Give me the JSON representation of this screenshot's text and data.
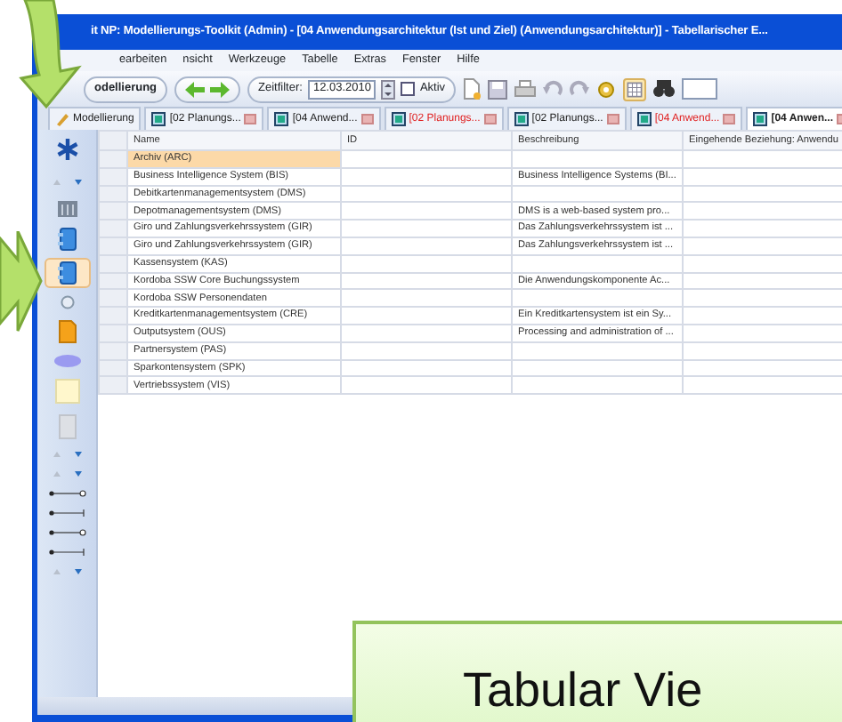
{
  "window": {
    "title": "it NP: Modellierungs-Toolkit (Admin) - [04 Anwendungsarchitektur (Ist und Ziel) (Anwendungsarchitektur)] - Tabellarischer E..."
  },
  "menu": [
    "earbeiten",
    "nsicht",
    "Werkzeuge",
    "Tabelle",
    "Extras",
    "Fenster",
    "Hilfe"
  ],
  "toolbar": {
    "mode": "odellierung",
    "filter_label": "Zeitfilter:",
    "date": "12.03.2010",
    "active": {
      "label": "Aktiv",
      "checked": false
    },
    "table_view_selected": true
  },
  "tabs": [
    {
      "label": "Modellierung",
      "color": "#222222",
      "selected": false
    },
    {
      "label": "[02 Planungs...",
      "color": "#222222",
      "selected": false
    },
    {
      "label": "[04 Anwend...",
      "color": "#222222",
      "selected": false
    },
    {
      "label": "[02 Planungs...",
      "color": "#e02020",
      "selected": false
    },
    {
      "label": "[02 Planungs...",
      "color": "#222222",
      "selected": false
    },
    {
      "label": "[04 Anwend...",
      "color": "#e02020",
      "selected": false
    },
    {
      "label": "[04 Anwen...",
      "color": "#222222",
      "selected": true
    }
  ],
  "sidebar": {
    "items": [
      {
        "kind": "asterisk",
        "selected": false
      },
      {
        "kind": "scroll",
        "selected": false
      },
      {
        "kind": "building",
        "selected": false
      },
      {
        "kind": "component",
        "selected": false
      },
      {
        "kind": "component",
        "selected": true
      },
      {
        "kind": "circle",
        "selected": false
      },
      {
        "kind": "document",
        "selected": false
      },
      {
        "kind": "ellipse",
        "selected": false
      },
      {
        "kind": "note",
        "selected": false
      },
      {
        "kind": "frame",
        "selected": false
      },
      {
        "kind": "scroll",
        "selected": false
      },
      {
        "kind": "scroll",
        "selected": false
      },
      {
        "kind": "connector-circle",
        "selected": false
      },
      {
        "kind": "connector-bar",
        "selected": false
      },
      {
        "kind": "connector-circle",
        "selected": false
      },
      {
        "kind": "connector-bar",
        "selected": false
      },
      {
        "kind": "scroll",
        "selected": false
      }
    ]
  },
  "table": {
    "columns": [
      "Name",
      "ID",
      "Beschreibung",
      "Eingehende Beziehung: Anwendu"
    ],
    "rows": [
      {
        "name": "Archiv (ARC)",
        "description": "",
        "selected": true
      },
      {
        "name": "Business Intelligence System (BIS)",
        "description": "Business Intelligence Systems (BI...",
        "selected": false
      },
      {
        "name": "Debitkartenmanagementsystem (DMS)",
        "description": "",
        "selected": false
      },
      {
        "name": "Depotmanagementsystem (DMS)",
        "description": "DMS is a web-based system pro...",
        "selected": false
      },
      {
        "name": "Giro und Zahlungsverkehrssystem (GIR)",
        "description": "Das Zahlungsverkehrssystem ist ...",
        "selected": false
      },
      {
        "name": "Giro und Zahlungsverkehrssystem (GIR)",
        "description": "Das Zahlungsverkehrssystem ist ...",
        "selected": false
      },
      {
        "name": "Kassensystem (KAS)",
        "description": "",
        "selected": false
      },
      {
        "name": "Kordoba SSW Core Buchungssystem",
        "description": "Die Anwendungskomponente Ac...",
        "selected": false
      },
      {
        "name": "Kordoba SSW Personendaten",
        "description": "",
        "selected": false
      },
      {
        "name": "Kreditkartenmanagementsystem (CRE)",
        "description": "Ein Kreditkartensystem ist ein Sy...",
        "selected": false
      },
      {
        "name": "Outputsystem (OUS)",
        "description": "Processing and administration of ...",
        "selected": false
      },
      {
        "name": "Partnersystem (PAS)",
        "description": "",
        "selected": false
      },
      {
        "name": "Sparkontensystem (SPK)",
        "description": "",
        "selected": false
      },
      {
        "name": "Vertriebssystem (VIS)",
        "description": "",
        "selected": false
      }
    ]
  },
  "callout": {
    "text": "Tabular Vie"
  }
}
